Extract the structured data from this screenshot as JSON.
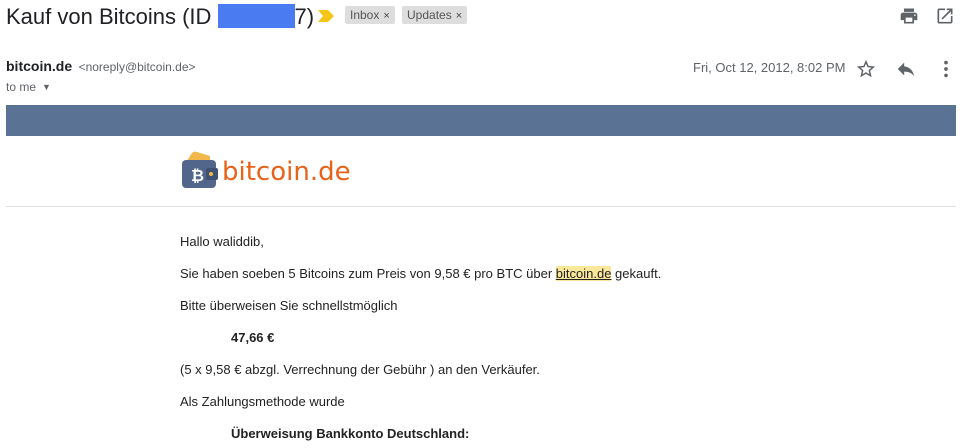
{
  "email": {
    "subject_prefix": "Kauf von Bitcoins (ID ",
    "subject_suffix": "7)",
    "labels": [
      {
        "name": "Inbox",
        "close": "×"
      },
      {
        "name": "Updates",
        "close": "×"
      }
    ],
    "sender_name": "bitcoin.de",
    "sender_email": "<noreply@bitcoin.de>",
    "recipient": "to me",
    "date": "Fri, Oct 12, 2012, 8:02 PM",
    "banner_color": "#5a7293",
    "logo_text": "bitcoin.de",
    "logo_color": "#e8621a"
  },
  "body": {
    "greeting": "Hallo waliddib,",
    "line1_pre": "Sie haben soeben 5 Bitcoins zum Preis von 9,58 € pro BTC über ",
    "line1_link": "bitcoin.de",
    "line1_post": " gekauft.",
    "line2": "Bitte überweisen Sie schnellstmöglich",
    "amount": "47,66 €",
    "line3": "(5 x 9,58 € abzgl. Verrechnung der Gebühr ) an den Verkäufer.",
    "line4": "Als Zahlungsmethode wurde",
    "method": "Überweisung Bankkonto Deutschland:"
  },
  "icons": [
    "important-marker-icon",
    "print-icon",
    "open-in-new-window-icon",
    "star-icon",
    "reply-icon",
    "more-options-icon",
    "bitcoin-wallet-logo-icon"
  ]
}
